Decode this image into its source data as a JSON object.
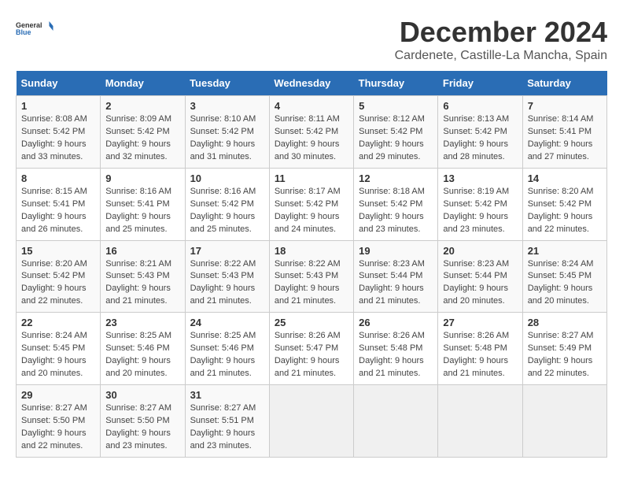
{
  "logo": {
    "text_general": "General",
    "text_blue": "Blue"
  },
  "title": "December 2024",
  "subtitle": "Cardenete, Castille-La Mancha, Spain",
  "days_of_week": [
    "Sunday",
    "Monday",
    "Tuesday",
    "Wednesday",
    "Thursday",
    "Friday",
    "Saturday"
  ],
  "weeks": [
    [
      {
        "day": "1",
        "sunrise": "8:08 AM",
        "sunset": "5:42 PM",
        "daylight": "9 hours and 33 minutes."
      },
      {
        "day": "2",
        "sunrise": "8:09 AM",
        "sunset": "5:42 PM",
        "daylight": "9 hours and 32 minutes."
      },
      {
        "day": "3",
        "sunrise": "8:10 AM",
        "sunset": "5:42 PM",
        "daylight": "9 hours and 31 minutes."
      },
      {
        "day": "4",
        "sunrise": "8:11 AM",
        "sunset": "5:42 PM",
        "daylight": "9 hours and 30 minutes."
      },
      {
        "day": "5",
        "sunrise": "8:12 AM",
        "sunset": "5:42 PM",
        "daylight": "9 hours and 29 minutes."
      },
      {
        "day": "6",
        "sunrise": "8:13 AM",
        "sunset": "5:42 PM",
        "daylight": "9 hours and 28 minutes."
      },
      {
        "day": "7",
        "sunrise": "8:14 AM",
        "sunset": "5:41 PM",
        "daylight": "9 hours and 27 minutes."
      }
    ],
    [
      {
        "day": "8",
        "sunrise": "8:15 AM",
        "sunset": "5:41 PM",
        "daylight": "9 hours and 26 minutes."
      },
      {
        "day": "9",
        "sunrise": "8:16 AM",
        "sunset": "5:41 PM",
        "daylight": "9 hours and 25 minutes."
      },
      {
        "day": "10",
        "sunrise": "8:16 AM",
        "sunset": "5:42 PM",
        "daylight": "9 hours and 25 minutes."
      },
      {
        "day": "11",
        "sunrise": "8:17 AM",
        "sunset": "5:42 PM",
        "daylight": "9 hours and 24 minutes."
      },
      {
        "day": "12",
        "sunrise": "8:18 AM",
        "sunset": "5:42 PM",
        "daylight": "9 hours and 23 minutes."
      },
      {
        "day": "13",
        "sunrise": "8:19 AM",
        "sunset": "5:42 PM",
        "daylight": "9 hours and 23 minutes."
      },
      {
        "day": "14",
        "sunrise": "8:20 AM",
        "sunset": "5:42 PM",
        "daylight": "9 hours and 22 minutes."
      }
    ],
    [
      {
        "day": "15",
        "sunrise": "8:20 AM",
        "sunset": "5:42 PM",
        "daylight": "9 hours and 22 minutes."
      },
      {
        "day": "16",
        "sunrise": "8:21 AM",
        "sunset": "5:43 PM",
        "daylight": "9 hours and 21 minutes."
      },
      {
        "day": "17",
        "sunrise": "8:22 AM",
        "sunset": "5:43 PM",
        "daylight": "9 hours and 21 minutes."
      },
      {
        "day": "18",
        "sunrise": "8:22 AM",
        "sunset": "5:43 PM",
        "daylight": "9 hours and 21 minutes."
      },
      {
        "day": "19",
        "sunrise": "8:23 AM",
        "sunset": "5:44 PM",
        "daylight": "9 hours and 21 minutes."
      },
      {
        "day": "20",
        "sunrise": "8:23 AM",
        "sunset": "5:44 PM",
        "daylight": "9 hours and 20 minutes."
      },
      {
        "day": "21",
        "sunrise": "8:24 AM",
        "sunset": "5:45 PM",
        "daylight": "9 hours and 20 minutes."
      }
    ],
    [
      {
        "day": "22",
        "sunrise": "8:24 AM",
        "sunset": "5:45 PM",
        "daylight": "9 hours and 20 minutes."
      },
      {
        "day": "23",
        "sunrise": "8:25 AM",
        "sunset": "5:46 PM",
        "daylight": "9 hours and 20 minutes."
      },
      {
        "day": "24",
        "sunrise": "8:25 AM",
        "sunset": "5:46 PM",
        "daylight": "9 hours and 21 minutes."
      },
      {
        "day": "25",
        "sunrise": "8:26 AM",
        "sunset": "5:47 PM",
        "daylight": "9 hours and 21 minutes."
      },
      {
        "day": "26",
        "sunrise": "8:26 AM",
        "sunset": "5:48 PM",
        "daylight": "9 hours and 21 minutes."
      },
      {
        "day": "27",
        "sunrise": "8:26 AM",
        "sunset": "5:48 PM",
        "daylight": "9 hours and 21 minutes."
      },
      {
        "day": "28",
        "sunrise": "8:27 AM",
        "sunset": "5:49 PM",
        "daylight": "9 hours and 22 minutes."
      }
    ],
    [
      {
        "day": "29",
        "sunrise": "8:27 AM",
        "sunset": "5:50 PM",
        "daylight": "9 hours and 22 minutes."
      },
      {
        "day": "30",
        "sunrise": "8:27 AM",
        "sunset": "5:50 PM",
        "daylight": "9 hours and 23 minutes."
      },
      {
        "day": "31",
        "sunrise": "8:27 AM",
        "sunset": "5:51 PM",
        "daylight": "9 hours and 23 minutes."
      },
      null,
      null,
      null,
      null
    ]
  ],
  "labels": {
    "sunrise": "Sunrise:",
    "sunset": "Sunset:",
    "daylight": "Daylight:"
  }
}
